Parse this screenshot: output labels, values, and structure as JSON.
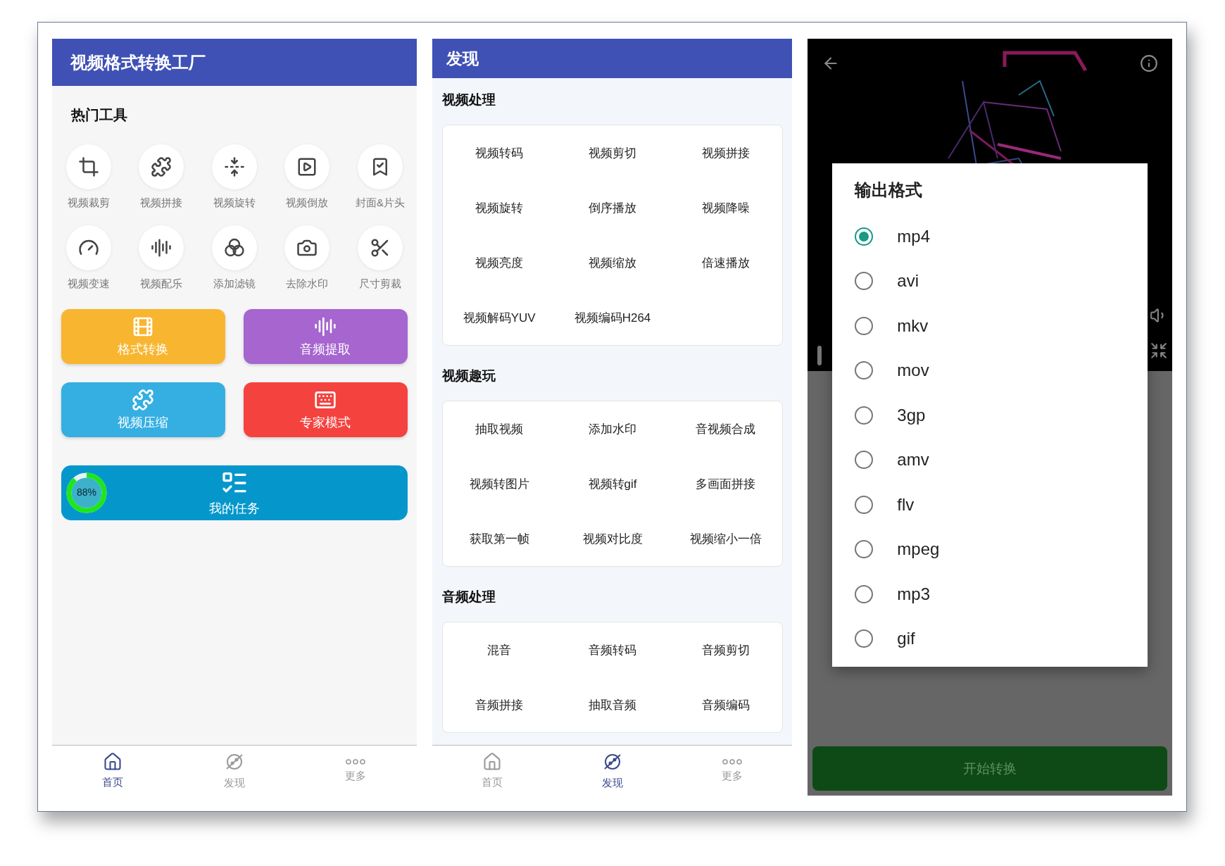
{
  "home": {
    "title": "视频格式转换工厂",
    "section": "热门工具",
    "tools": [
      {
        "label": "视频裁剪"
      },
      {
        "label": "视频拼接"
      },
      {
        "label": "视频旋转"
      },
      {
        "label": "视频倒放"
      },
      {
        "label": "封面&片头"
      },
      {
        "label": "视频变速"
      },
      {
        "label": "视频配乐"
      },
      {
        "label": "添加滤镜"
      },
      {
        "label": "去除水印"
      },
      {
        "label": "尺寸剪裁"
      }
    ],
    "actions": [
      {
        "label": "格式转换",
        "color": "#f8b52f"
      },
      {
        "label": "音频提取",
        "color": "#a665cf"
      },
      {
        "label": "视频压缩",
        "color": "#35afe2"
      },
      {
        "label": "专家模式",
        "color": "#f4423f"
      }
    ],
    "task": {
      "label": "我的任务",
      "progress": "88%",
      "level": 0.88
    },
    "nav": [
      {
        "label": "首页",
        "selected": true
      },
      {
        "label": "发现",
        "selected": false
      },
      {
        "label": "更多",
        "selected": false
      }
    ]
  },
  "discover": {
    "title": "发现",
    "sections": [
      {
        "title": "视频处理",
        "items": [
          "视频转码",
          "视频剪切",
          "视频拼接",
          "视频旋转",
          "倒序播放",
          "视频降噪",
          "视频亮度",
          "视频缩放",
          "倍速播放",
          "视频解码YUV",
          "视频编码H264"
        ]
      },
      {
        "title": "视频趣玩",
        "items": [
          "抽取视频",
          "添加水印",
          "音视频合成",
          "视频转图片",
          "视频转gif",
          "多画面拼接",
          "获取第一帧",
          "视频对比度",
          "视频缩小一倍"
        ]
      },
      {
        "title": "音频处理",
        "items": [
          "混音",
          "音频转码",
          "音频剪切",
          "音频拼接",
          "抽取音频",
          "音频编码"
        ]
      }
    ],
    "nav": [
      {
        "label": "首页",
        "selected": false
      },
      {
        "label": "发现",
        "selected": true
      },
      {
        "label": "更多",
        "selected": false
      }
    ]
  },
  "converter": {
    "dialog": {
      "title": "输出格式",
      "options": [
        {
          "label": "mp4",
          "selected": true
        },
        {
          "label": "avi",
          "selected": false
        },
        {
          "label": "mkv",
          "selected": false
        },
        {
          "label": "mov",
          "selected": false
        },
        {
          "label": "3gp",
          "selected": false
        },
        {
          "label": "amv",
          "selected": false
        },
        {
          "label": "flv",
          "selected": false
        },
        {
          "label": "mpeg",
          "selected": false
        },
        {
          "label": "mp3",
          "selected": false
        },
        {
          "label": "gif",
          "selected": false
        }
      ]
    },
    "button": "开始转换"
  }
}
